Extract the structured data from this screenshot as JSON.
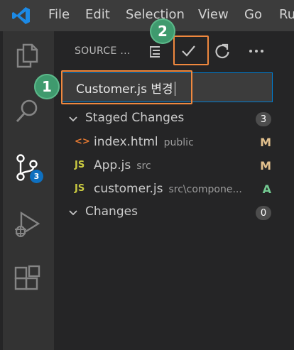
{
  "menubar": {
    "items": [
      "File",
      "Edit",
      "Selection",
      "View",
      "Go",
      "Ru"
    ]
  },
  "activitybar": {
    "items": [
      {
        "name": "explorer",
        "icon": "files-icon"
      },
      {
        "name": "search",
        "icon": "search-icon"
      },
      {
        "name": "source-control",
        "icon": "source-control-icon",
        "badge": "3",
        "active": true
      },
      {
        "name": "run-debug",
        "icon": "run-debug-icon"
      },
      {
        "name": "extensions",
        "icon": "extensions-icon"
      }
    ]
  },
  "scm": {
    "title": "SOURCE ...",
    "toolbar": {
      "view_icon": "list-tree-icon",
      "commit_icon": "check-icon",
      "refresh_icon": "refresh-icon",
      "more_icon": "ellipsis-icon"
    },
    "message": {
      "value": "Customer.js 변경"
    },
    "staged": {
      "label": "Staged Changes",
      "count": "3",
      "files": [
        {
          "icon": "<>",
          "icon_color": "#e37933",
          "name": "index.html",
          "path": "public",
          "status": "M",
          "status_color": "#e2c08d"
        },
        {
          "icon": "JS",
          "icon_color": "#cbcb41",
          "name": "App.js",
          "path": "src",
          "status": "M",
          "status_color": "#e2c08d"
        },
        {
          "icon": "JS",
          "icon_color": "#cbcb41",
          "name": "customer.js",
          "path": "src\\compone...",
          "status": "A",
          "status_color": "#73c991"
        }
      ]
    },
    "changes": {
      "label": "Changes",
      "count": "0"
    }
  },
  "annotations": {
    "step1": "1",
    "step2": "2"
  }
}
